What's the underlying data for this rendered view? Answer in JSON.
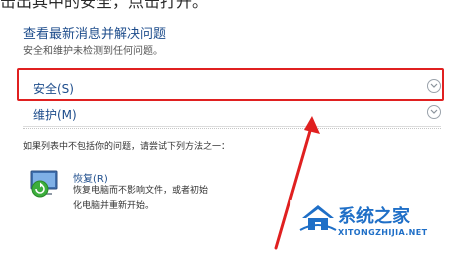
{
  "top_caption": "击出其中的安全，点击打开。",
  "header": {
    "title": "查看最新消息并解决问题",
    "subtitle": "安全和维护未检测到任何问题。"
  },
  "sections": [
    {
      "label": "安全(S)"
    },
    {
      "label": "维护(M)"
    }
  ],
  "hint": "如果列表中不包括你的问题，请尝试下列方法之一：",
  "recovery": {
    "title": "恢复(R)",
    "description_line1": "恢复电脑而不影响文件，或者初始",
    "description_line2": "化电脑并重新开始。"
  },
  "watermark": {
    "cn": "系统之家",
    "en": "XITONGZHIJIA.NET"
  },
  "colors": {
    "highlight_box": "#e02020",
    "arrow": "#e02020",
    "link": "#1e4d8c",
    "watermark": "#1f6fc7"
  }
}
